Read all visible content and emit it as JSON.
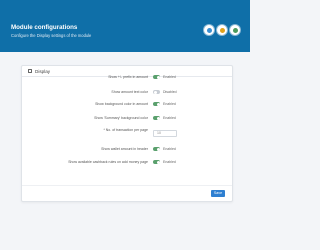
{
  "header": {
    "title": "Module configurations",
    "subtitle": "Configure the Display settings of the module",
    "badges": [
      {
        "icon": "globe-icon",
        "color": "#3b8fd0"
      },
      {
        "icon": "award-icon",
        "color": "#e0a21b"
      },
      {
        "icon": "user-icon",
        "color": "#4c9a5d"
      }
    ]
  },
  "panel": {
    "icon": "gear-icon",
    "title": "Display"
  },
  "settings": [
    {
      "label": "Show +/- prefix in amount",
      "type": "toggle",
      "state": true,
      "state_label": "Enabled"
    },
    {
      "label": "Show amount text color",
      "type": "toggle",
      "state": false,
      "state_label": "Disabled"
    },
    {
      "label": "Show background color in amount",
      "type": "toggle",
      "state": true,
      "state_label": "Enabled"
    },
    {
      "label": "Show 'Summary' background color",
      "type": "toggle",
      "state": true,
      "state_label": "Enabled"
    },
    {
      "label": "* No. of transaction per page",
      "type": "number",
      "value": "10"
    },
    {
      "label": "Show wallet amount in header",
      "type": "toggle",
      "state": true,
      "state_label": "Enabled"
    },
    {
      "label": "Show available cashback rules on add money page",
      "type": "toggle",
      "state": true,
      "state_label": "Enabled"
    }
  ],
  "footer": {
    "save_label": "Save"
  }
}
